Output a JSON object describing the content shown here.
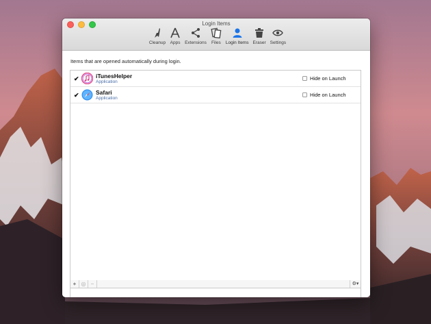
{
  "window": {
    "title": "Login Items"
  },
  "toolbar": {
    "items": [
      {
        "label": "Cleanup",
        "icon": "broom-icon"
      },
      {
        "label": "Apps",
        "icon": "apps-icon"
      },
      {
        "label": "Extensions",
        "icon": "share-icon"
      },
      {
        "label": "Files",
        "icon": "files-icon"
      },
      {
        "label": "Login Items",
        "icon": "user-icon",
        "active": true
      },
      {
        "label": "Eraser",
        "icon": "trash-icon"
      },
      {
        "label": "Settings",
        "icon": "eye-icon"
      }
    ]
  },
  "content": {
    "description": "Items that are opened automatically during login.",
    "rows": [
      {
        "name": "iTunesHelper",
        "type": "Application",
        "checked": true,
        "hide_label": "Hide on Launch",
        "hide_checked": false
      },
      {
        "name": "Safari",
        "type": "Application",
        "checked": true,
        "hide_label": "Hide on Launch",
        "hide_checked": false
      }
    ]
  },
  "bottombar": {
    "add": "+",
    "reveal": "◎",
    "remove": "−",
    "gear": "⚙▾"
  },
  "colors": {
    "accent": "#1a73e8",
    "subtitle": "#4a6ea8"
  }
}
